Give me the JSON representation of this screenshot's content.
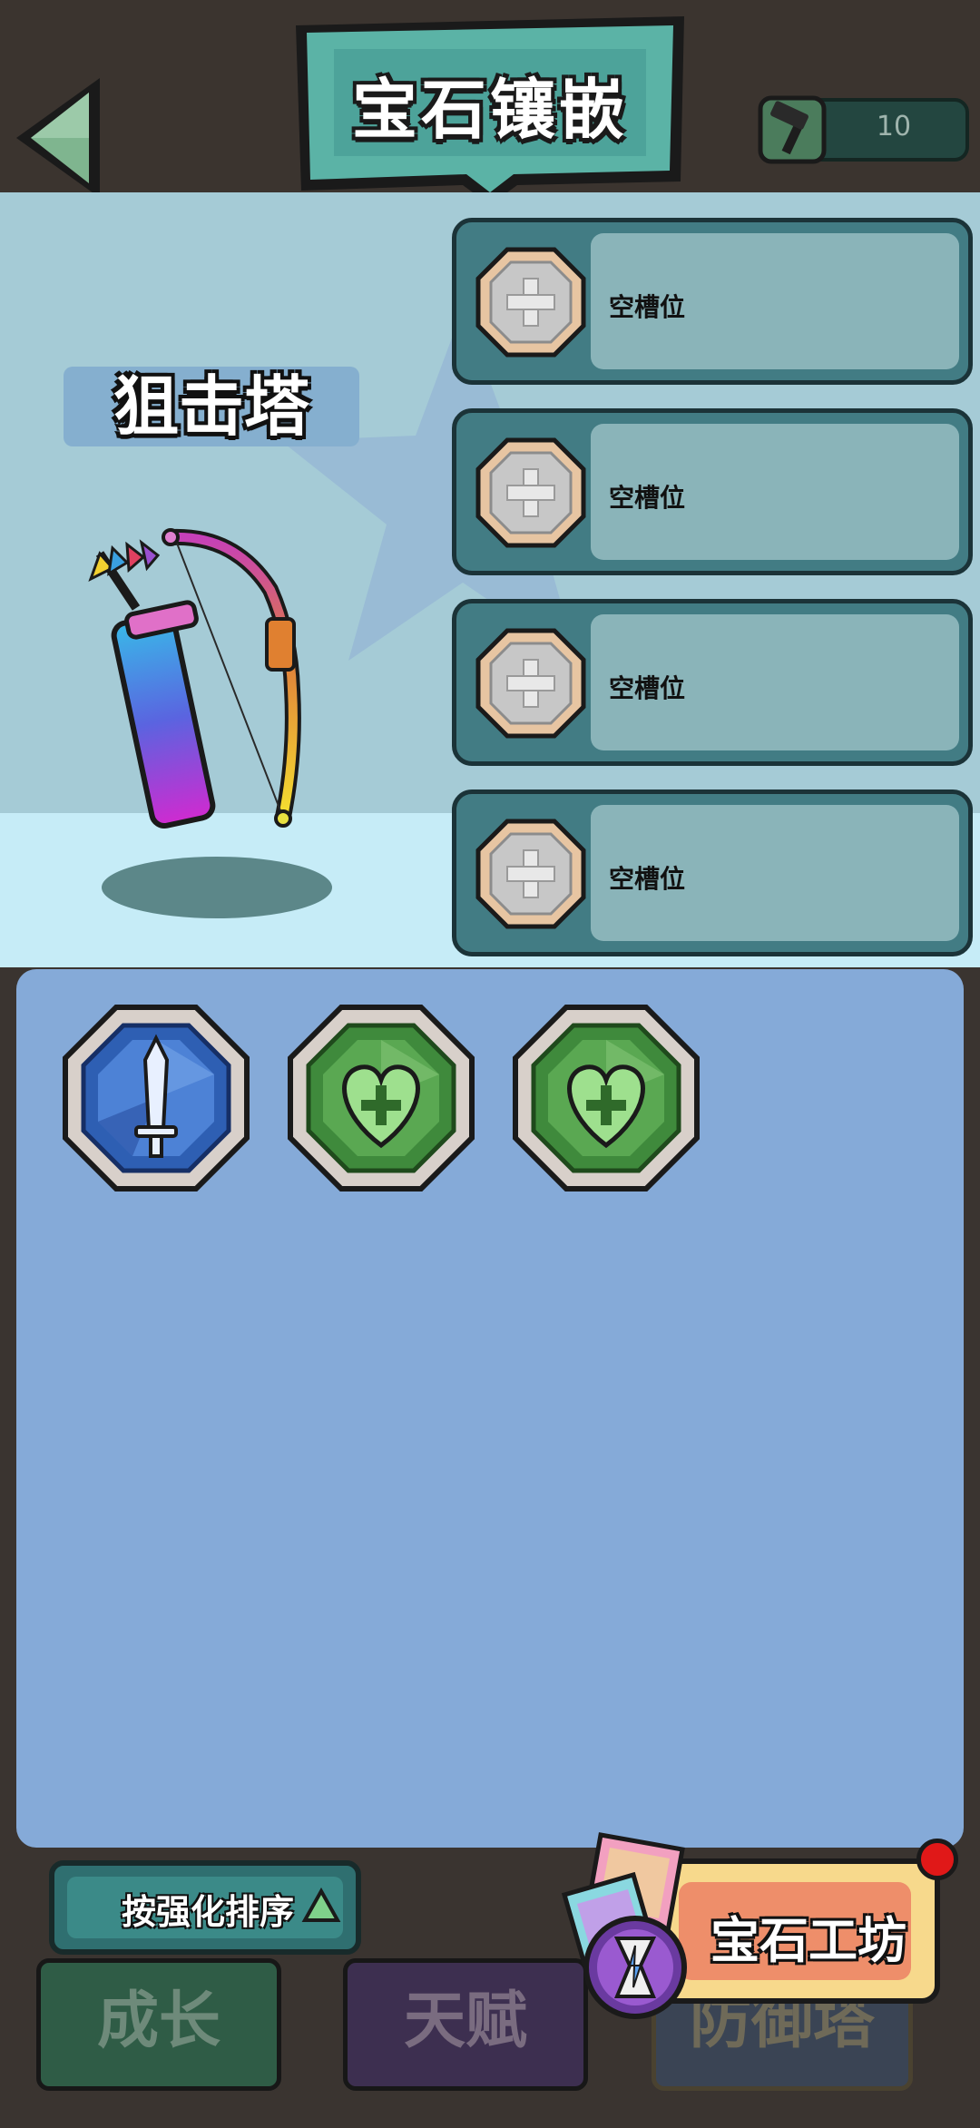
{
  "header": {
    "title": "宝石镶嵌",
    "hammer_count": "10"
  },
  "tower": {
    "name": "狙击塔"
  },
  "slots": [
    {
      "label": "空槽位"
    },
    {
      "label": "空槽位"
    },
    {
      "label": "空槽位"
    },
    {
      "label": "空槽位"
    }
  ],
  "gems": [
    {
      "type": "attack-sword",
      "color": "#2e5fb3"
    },
    {
      "type": "health-heart",
      "color": "#4f9a46"
    },
    {
      "type": "health-heart",
      "color": "#4f9a46"
    }
  ],
  "sort": {
    "label": "按强化排序"
  },
  "tabs": [
    {
      "label": "成长"
    },
    {
      "label": "天赋"
    },
    {
      "label": "防御塔"
    }
  ],
  "workshop": {
    "label": "宝石工坊",
    "has_notification": true
  }
}
